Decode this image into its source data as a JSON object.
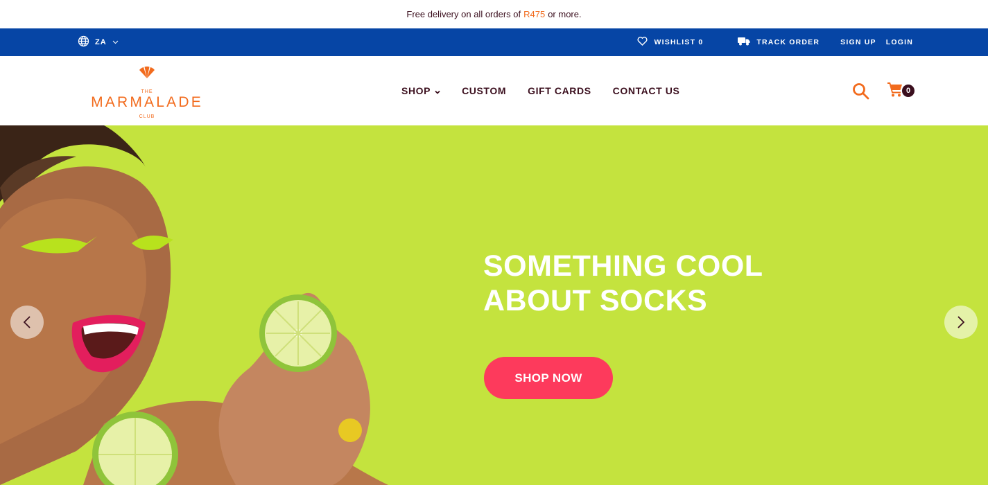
{
  "announcement": {
    "prefix": "Free delivery on all orders of",
    "amount": "R475",
    "suffix": "or more."
  },
  "utility": {
    "region": "ZA",
    "wishlist": "WISHLIST 0",
    "track_order": "TRACK ORDER",
    "sign_up": "SIGN UP",
    "login": "LOGIN"
  },
  "logo": {
    "top": "THE",
    "name": "MARMALADE",
    "bottom": "CLUB"
  },
  "nav": {
    "items": [
      {
        "label": "SHOP"
      },
      {
        "label": "CUSTOM"
      },
      {
        "label": "GIFT CARDS"
      },
      {
        "label": "CONTACT US"
      }
    ]
  },
  "cart": {
    "count": "0"
  },
  "hero": {
    "title_line1": "SOMETHING COOL",
    "title_line2": "ABOUT SOCKS",
    "cta": "SHOP NOW"
  },
  "icons": {
    "globe": "globe-icon",
    "heart": "heart-icon",
    "truck": "truck-icon",
    "search": "search-icon",
    "cart": "cart-icon",
    "prev": "chevron-left-icon",
    "next": "chevron-right-icon"
  },
  "colors": {
    "utility_bar": "#0645a5",
    "brand_orange": "#f26b1d",
    "hero_background": "#c4e33e",
    "cta": "#fd3a5c",
    "text_dark": "#3b0f1e"
  }
}
